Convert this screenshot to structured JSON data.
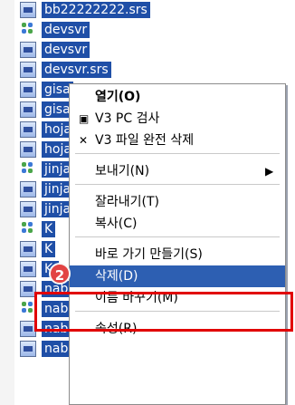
{
  "file_list": [
    {
      "name": "bb22222222.srs",
      "icon": "file-icon"
    },
    {
      "name": "devsvr",
      "icon": "group-icon"
    },
    {
      "name": "devsvr",
      "icon": "file-icon"
    },
    {
      "name": "devsvr.srs",
      "icon": "file-icon"
    },
    {
      "name": "gisa",
      "icon": "file-icon"
    },
    {
      "name": "gisa",
      "icon": "file-icon"
    },
    {
      "name": "hoja",
      "icon": "file-icon"
    },
    {
      "name": "hoja",
      "icon": "file-icon"
    },
    {
      "name": "jinja",
      "icon": "group-icon"
    },
    {
      "name": "jinja",
      "icon": "file-icon"
    },
    {
      "name": "jinja",
      "icon": "file-icon"
    },
    {
      "name": "K",
      "icon": "group-icon"
    },
    {
      "name": "K",
      "icon": "file-icon"
    },
    {
      "name": "K-",
      "icon": "file-icon"
    },
    {
      "name": "nab",
      "icon": "file-icon"
    },
    {
      "name": "nab",
      "icon": "group-icon"
    },
    {
      "name": "nab",
      "icon": "file-icon"
    },
    {
      "name": "nabonbu",
      "icon": "file-icon"
    }
  ],
  "context_menu": {
    "open": "열기(O)",
    "v3_scan": "V3 PC 검사",
    "v3_delete": "V3 파일 완전 삭제",
    "send_to": "보내기(N)",
    "cut": "잘라내기(T)",
    "copy": "복사(C)",
    "create_shortcut": "바로 가기 만들기(S)",
    "delete": "삭제(D)",
    "rename": "이름 바꾸기(M)",
    "properties": "속성(R)"
  },
  "annotation": {
    "step_number": "2",
    "accent_color": "#e10000"
  }
}
